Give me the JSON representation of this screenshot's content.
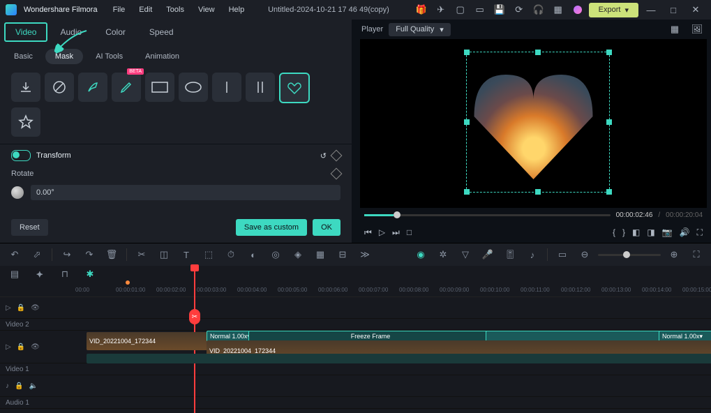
{
  "brand": "Wondershare Filmora",
  "menu": [
    "File",
    "Edit",
    "Tools",
    "View",
    "Help"
  ],
  "title": "Untitled-2024-10-21 17 46 49(copy)",
  "export_label": "Export",
  "tabs1": {
    "video": "Video",
    "audio": "Audio",
    "color": "Color",
    "speed": "Speed"
  },
  "tabs2": {
    "basic": "Basic",
    "mask": "Mask",
    "aitools": "AI Tools",
    "animation": "Animation"
  },
  "beta_label": "BETA",
  "transform_label": "Transform",
  "rotate_label": "Rotate",
  "rotate_value": "0.00°",
  "reset_label": "Reset",
  "save_custom_label": "Save as custom",
  "ok_label": "OK",
  "player_label": "Player",
  "quality_label": "Full Quality",
  "time_current": "00:00:02:46",
  "time_total": "00:00:20:04",
  "ruler_ticks": [
    "00:00",
    "00:00:01:00",
    "00:00:02:00",
    "00:00:03:00",
    "00:00:04:00",
    "00:00:05:00",
    "00:00:06:00",
    "00:00:07:00",
    "00:00:08:00",
    "00:00:09:00",
    "00:00:10:00",
    "00:00:11:00",
    "00:00:12:00",
    "00:00:13:00",
    "00:00:14:00",
    "00:00:15:00"
  ],
  "tracks": {
    "video2": "Video 2",
    "video1": "Video 1",
    "audio1": "Audio 1"
  },
  "clips": {
    "v1": "VID_20221004_172344",
    "v2": "VID_20221004_172344",
    "speed": "Normal 1.00x",
    "freeze": "Freeze Frame",
    "speed2": "Normal 1.00x"
  }
}
